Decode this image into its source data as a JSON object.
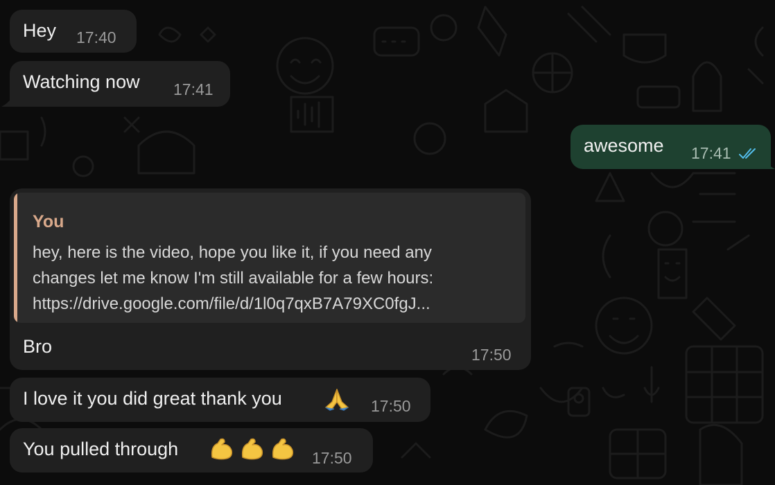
{
  "messages": [
    {
      "text": "Hey",
      "time": "17:40",
      "direction": "incoming"
    },
    {
      "text": "Watching now",
      "time": "17:41",
      "direction": "incoming"
    },
    {
      "text": "awesome",
      "time": "17:41",
      "direction": "outgoing",
      "status": "read",
      "status_icon": "double-check-icon"
    },
    {
      "text": "Bro",
      "time": "17:50",
      "direction": "incoming",
      "reply": {
        "author": "You",
        "lines": [
          "hey, here is the video, hope you like it, if you need any",
          "changes let me know I'm still available for a few hours:",
          "https://drive.google.com/file/d/1l0q7qxB7A79XC0fgJ..."
        ]
      }
    },
    {
      "text": "I love it you did great thank you",
      "time": "17:50",
      "direction": "incoming",
      "emoji": [
        "folded-hands-emoji"
      ]
    },
    {
      "text": "You pulled through",
      "time": "17:50",
      "direction": "incoming",
      "emoji": [
        "flexed-biceps-emoji",
        "flexed-biceps-emoji",
        "flexed-biceps-emoji"
      ]
    }
  ],
  "colors": {
    "background": "#0c0c0c",
    "incoming_bubble": "#202020",
    "outgoing_bubble": "#1e4130",
    "quote_accent": "#d9a98b",
    "read_check": "#53bdeb"
  }
}
